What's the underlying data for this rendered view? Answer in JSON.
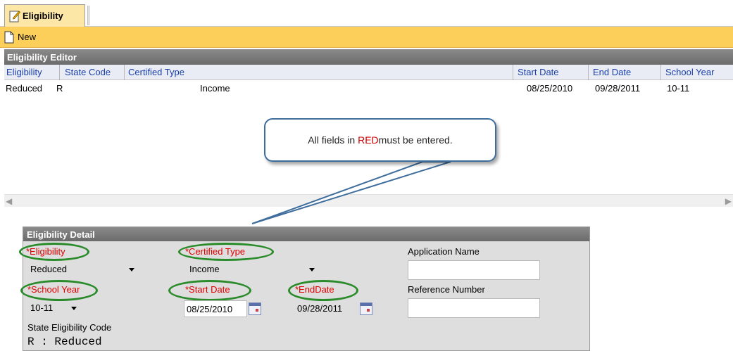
{
  "tab": {
    "label": "Eligibility",
    "icon": "edit-document-icon"
  },
  "toolbar": {
    "new_label": "New",
    "icon": "new-document-icon"
  },
  "editor": {
    "title": "Eligibility Editor",
    "columns": [
      "Eligibility",
      "State Code",
      "Certified Type",
      "Start Date",
      "End Date",
      "School Year"
    ],
    "rows": [
      {
        "eligibility": "Reduced",
        "state_code": "R",
        "certified_type": "Income",
        "start_date": "08/25/2010",
        "end_date": "09/28/2011",
        "school_year": "10-11"
      }
    ]
  },
  "callout": {
    "prefix": "All fields in ",
    "highlight": "RED",
    "suffix": " must be entered."
  },
  "detail": {
    "title": "Eligibility Detail",
    "eligibility": {
      "label": "*Eligibility",
      "value": "Reduced"
    },
    "certified_type": {
      "label": "*Certified Type",
      "value": "Income"
    },
    "application_name": {
      "label": "Application Name",
      "value": ""
    },
    "school_year": {
      "label": "*School Year",
      "value": "10-11"
    },
    "start_date": {
      "label": "*Start Date",
      "value": "08/25/2010"
    },
    "end_date": {
      "label": "*EndDate",
      "value": "09/28/2011"
    },
    "reference_number": {
      "label": "Reference Number",
      "value": ""
    },
    "state_code": {
      "label": "State Eligibility Code",
      "value": "R : Reduced"
    }
  },
  "colors": {
    "toolbar": "#fccf5b",
    "required": "#e00000",
    "highlight_oval": "#2a8b2a",
    "header_link": "#1a3fa9"
  }
}
